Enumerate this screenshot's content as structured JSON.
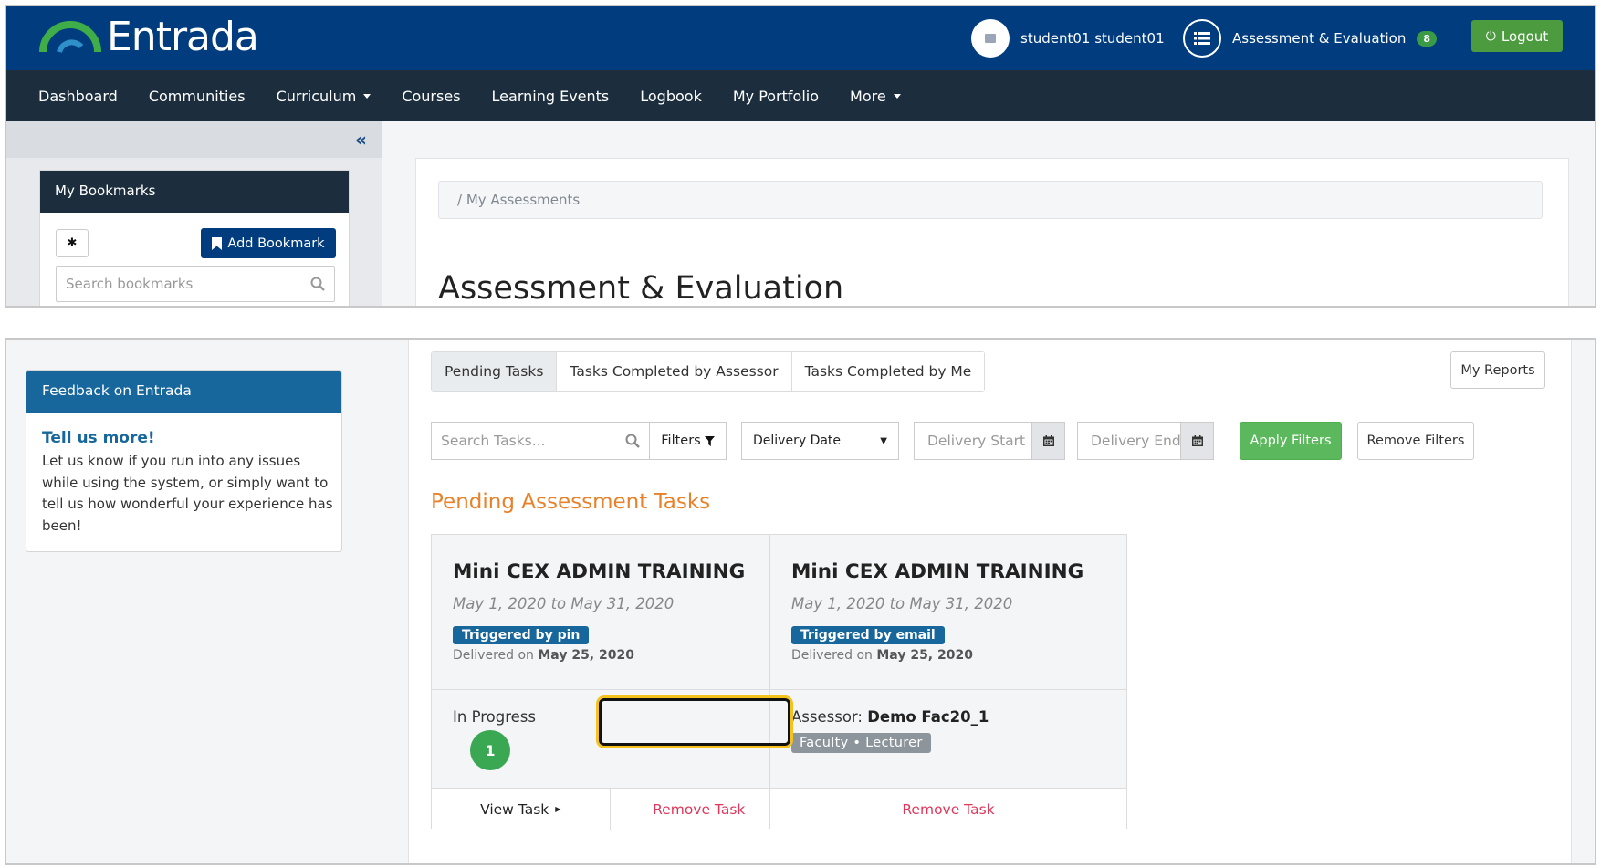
{
  "header": {
    "brand": "Entrada",
    "user_name": "student01 student01",
    "ae_link": "Assessment & Evaluation",
    "ae_count": "8",
    "logout_label": "Logout"
  },
  "nav": {
    "items": [
      "Dashboard",
      "Communities",
      "Curriculum",
      "Courses",
      "Learning Events",
      "Logbook",
      "My Portfolio",
      "More"
    ]
  },
  "bookmarks": {
    "title": "My Bookmarks",
    "add_label": "Add Bookmark",
    "search_placeholder": "Search bookmarks"
  },
  "breadcrumb": "/  My Assessments",
  "page_title": "Assessment & Evaluation",
  "feedback": {
    "header": "Feedback on Entrada",
    "title": "Tell us more!",
    "text": "Let us know if you run into any issues while using the system, or simply want to tell us how wonderful your experience has been!"
  },
  "tabs": [
    "Pending Tasks",
    "Tasks Completed by Assessor",
    "Tasks Completed by Me"
  ],
  "my_reports_label": "My Reports",
  "filters": {
    "search_placeholder": "Search Tasks...",
    "filters_label": "Filters",
    "delivery_date": "Delivery Date",
    "start_placeholder": "Delivery Start",
    "end_placeholder": "Delivery End",
    "apply_label": "Apply Filters",
    "remove_label": "Remove Filters"
  },
  "section_title": "Pending Assessment Tasks",
  "cards": [
    {
      "title": "Mini CEX ADMIN TRAINING",
      "dates": "May 1, 2020 to May 31, 2020",
      "badge": "Triggered by pin",
      "delivered_prefix": "Delivered on",
      "delivered_date": "May 25, 2020",
      "status": "In Progress",
      "progress_count": "1",
      "view_label": "View Task",
      "remove_label": "Remove Task"
    },
    {
      "title": "Mini CEX ADMIN TRAINING",
      "dates": "May 1, 2020 to May 31, 2020",
      "badge": "Triggered by email",
      "delivered_prefix": "Delivered on",
      "delivered_date": "May 25, 2020",
      "assessor_prefix": "Assessor:",
      "assessor_name": "Demo Fac20_1",
      "role": "Faculty • Lecturer",
      "remove_label": "Remove Task"
    }
  ],
  "colors": {
    "header_bg": "#003c7e",
    "nav_bg": "#1c2e3d",
    "accent_orange": "#e8822a",
    "success_green": "#5cb85c",
    "remove_red": "#e0365a",
    "highlight": "#f4c21a"
  }
}
